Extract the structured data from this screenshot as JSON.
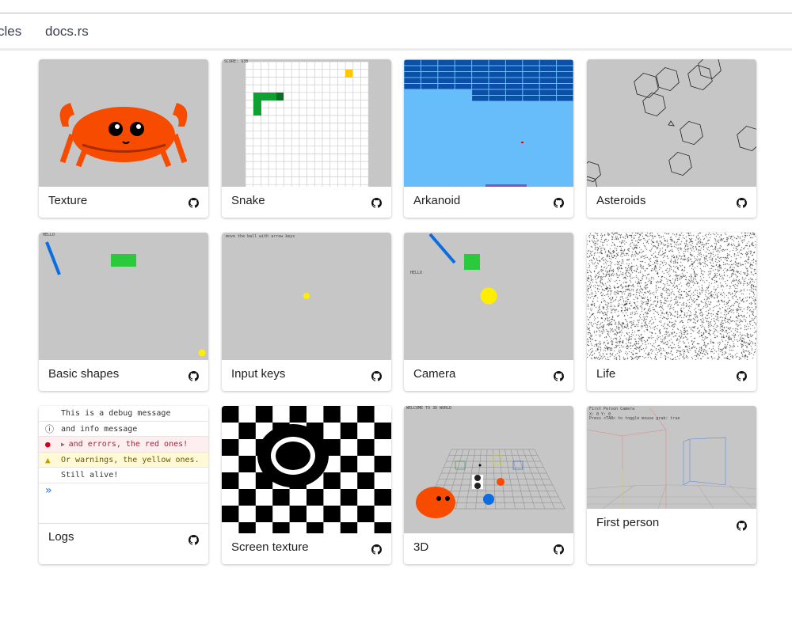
{
  "nav": {
    "items": [
      {
        "label": "cles"
      },
      {
        "label": "docs.rs"
      }
    ]
  },
  "cards": [
    {
      "title": "Texture",
      "icon": "github-icon"
    },
    {
      "title": "Snake",
      "icon": "github-icon",
      "overlay": "SCORE: 938"
    },
    {
      "title": "Arkanoid",
      "icon": "github-icon"
    },
    {
      "title": "Asteroids",
      "icon": "github-icon"
    },
    {
      "title": "Basic shapes",
      "icon": "github-icon",
      "overlay": "HELLO"
    },
    {
      "title": "Input keys",
      "icon": "github-icon",
      "overlay": "move the ball with arrow keys"
    },
    {
      "title": "Camera",
      "icon": "github-icon",
      "overlay": "HELLO"
    },
    {
      "title": "Life",
      "icon": "github-icon"
    },
    {
      "title": "Logs",
      "icon": "github-icon"
    },
    {
      "title": "Screen texture",
      "icon": "github-icon"
    },
    {
      "title": "3D",
      "icon": "github-icon",
      "overlay": "WELCOME TO 3D WORLD"
    },
    {
      "title": "First person",
      "icon": "github-icon",
      "overlay": "First Person Camera",
      "overlay2": "X: 0 Y: 0",
      "overlay3": "Press <TAB> to toggle mouse grab: true"
    }
  ],
  "logs": [
    {
      "text": "This is a debug message",
      "level": "debug"
    },
    {
      "text": "and info message",
      "level": "info"
    },
    {
      "text": "and errors, the red ones!",
      "level": "error"
    },
    {
      "text": "Or warnings, the yellow ones.",
      "level": "warning"
    },
    {
      "text": "Still alive!",
      "level": "log"
    }
  ],
  "prompt_icon": "chevron-double-right-icon",
  "colors": {
    "card_bg": "#c6c6c6",
    "rust_orange": "#f74c00",
    "green": "#2bc93c",
    "yellow": "#ffee00",
    "blue": "#0a6de0"
  }
}
